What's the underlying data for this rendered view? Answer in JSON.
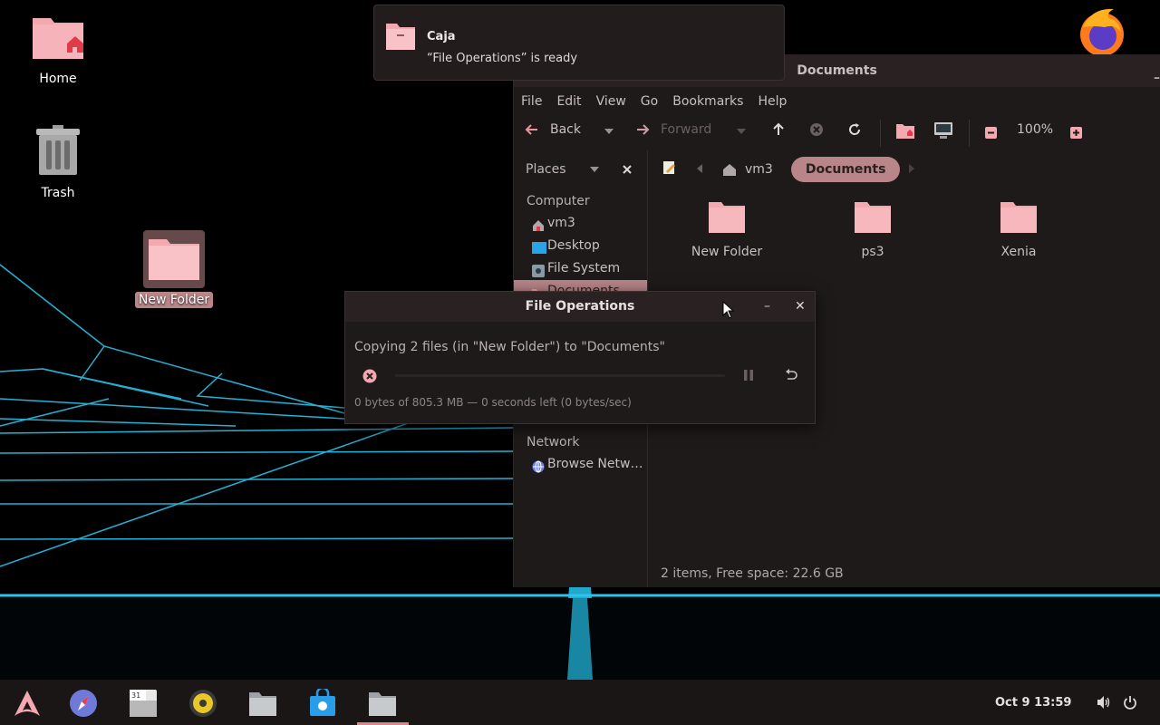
{
  "colors": {
    "accent": "#b88588",
    "folder": "#f4a9b0",
    "window_bg": "#1f1a1a",
    "titlebar_bg": "#2a2222",
    "neon": "#27c6ee"
  },
  "desktop": {
    "icons": [
      {
        "label": "Home",
        "icon": "home-folder-icon"
      },
      {
        "label": "Trash",
        "icon": "trash-icon"
      },
      {
        "label": "New Folder",
        "icon": "folder-icon",
        "selected": true
      }
    ]
  },
  "notification": {
    "app": "Caja",
    "message": "“File Operations” is ready"
  },
  "caja": {
    "title": "Documents",
    "menu": [
      "File",
      "Edit",
      "View",
      "Go",
      "Bookmarks",
      "Help"
    ],
    "toolbar": {
      "back": "Back",
      "forward": "Forward",
      "zoom": "100%"
    },
    "sidebar": {
      "header": "Places",
      "sections": [
        {
          "title": "Computer",
          "items": [
            {
              "label": "vm3",
              "icon": "home-icon"
            },
            {
              "label": "Desktop",
              "icon": "desktop-icon"
            },
            {
              "label": "File System",
              "icon": "drive-icon"
            },
            {
              "label": "Documents",
              "icon": "folder-icon",
              "selected": true
            }
          ]
        },
        {
          "title": "Network",
          "items": [
            {
              "label": "Browse Netw…",
              "icon": "network-icon"
            }
          ]
        }
      ]
    },
    "path": {
      "home": "vm3",
      "current": "Documents"
    },
    "files": [
      {
        "name": "New Folder"
      },
      {
        "name": "ps3"
      },
      {
        "name": "Xenia"
      }
    ],
    "status": "2 items, Free space: 22.6 GB"
  },
  "fileops": {
    "title": "File Operations",
    "operation": "Copying 2 files (in \"New Folder\") to \"Documents\"",
    "progress": 0,
    "detail": "0 bytes of 805.3 MB — 0 seconds left (0 bytes/sec)"
  },
  "taskbar": {
    "apps": [
      "arch-menu-icon",
      "web-browser-icon",
      "calendar-icon",
      "music-player-icon",
      "files-icon",
      "software-store-icon",
      "file-manager-icon"
    ],
    "clock": "Oct 9  13:59"
  }
}
